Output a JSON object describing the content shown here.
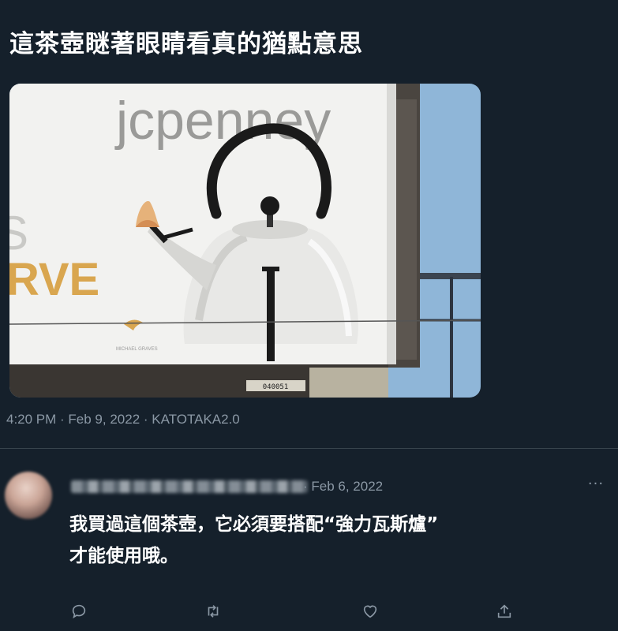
{
  "tweet": {
    "text": "這茶壺瞇著眼睛看真的猶點意思",
    "image": {
      "billboard_brand": "jcpenney",
      "billboard_left_fragment_1": "S",
      "billboard_left_fragment_2": "RVE",
      "billboard_small_logo": "MICHAEL GRAVES",
      "billboard_plate": "040051"
    },
    "timestamp": "4:20 PM · Feb 9, 2022 · KATOTAKA2.0"
  },
  "reply": {
    "date": "· Feb 6, 2022",
    "more_label": "···",
    "text_line_1": "我買過這個茶壺，它必須要搭配“強力瓦斯爐”",
    "text_line_2": "才能使用哦。"
  },
  "actions": {
    "icons": [
      "reply-icon",
      "retweet-icon",
      "like-icon",
      "share-icon"
    ]
  },
  "colors": {
    "background": "#15202b",
    "secondary_text": "#8b98a5",
    "divider": "#38444d"
  }
}
